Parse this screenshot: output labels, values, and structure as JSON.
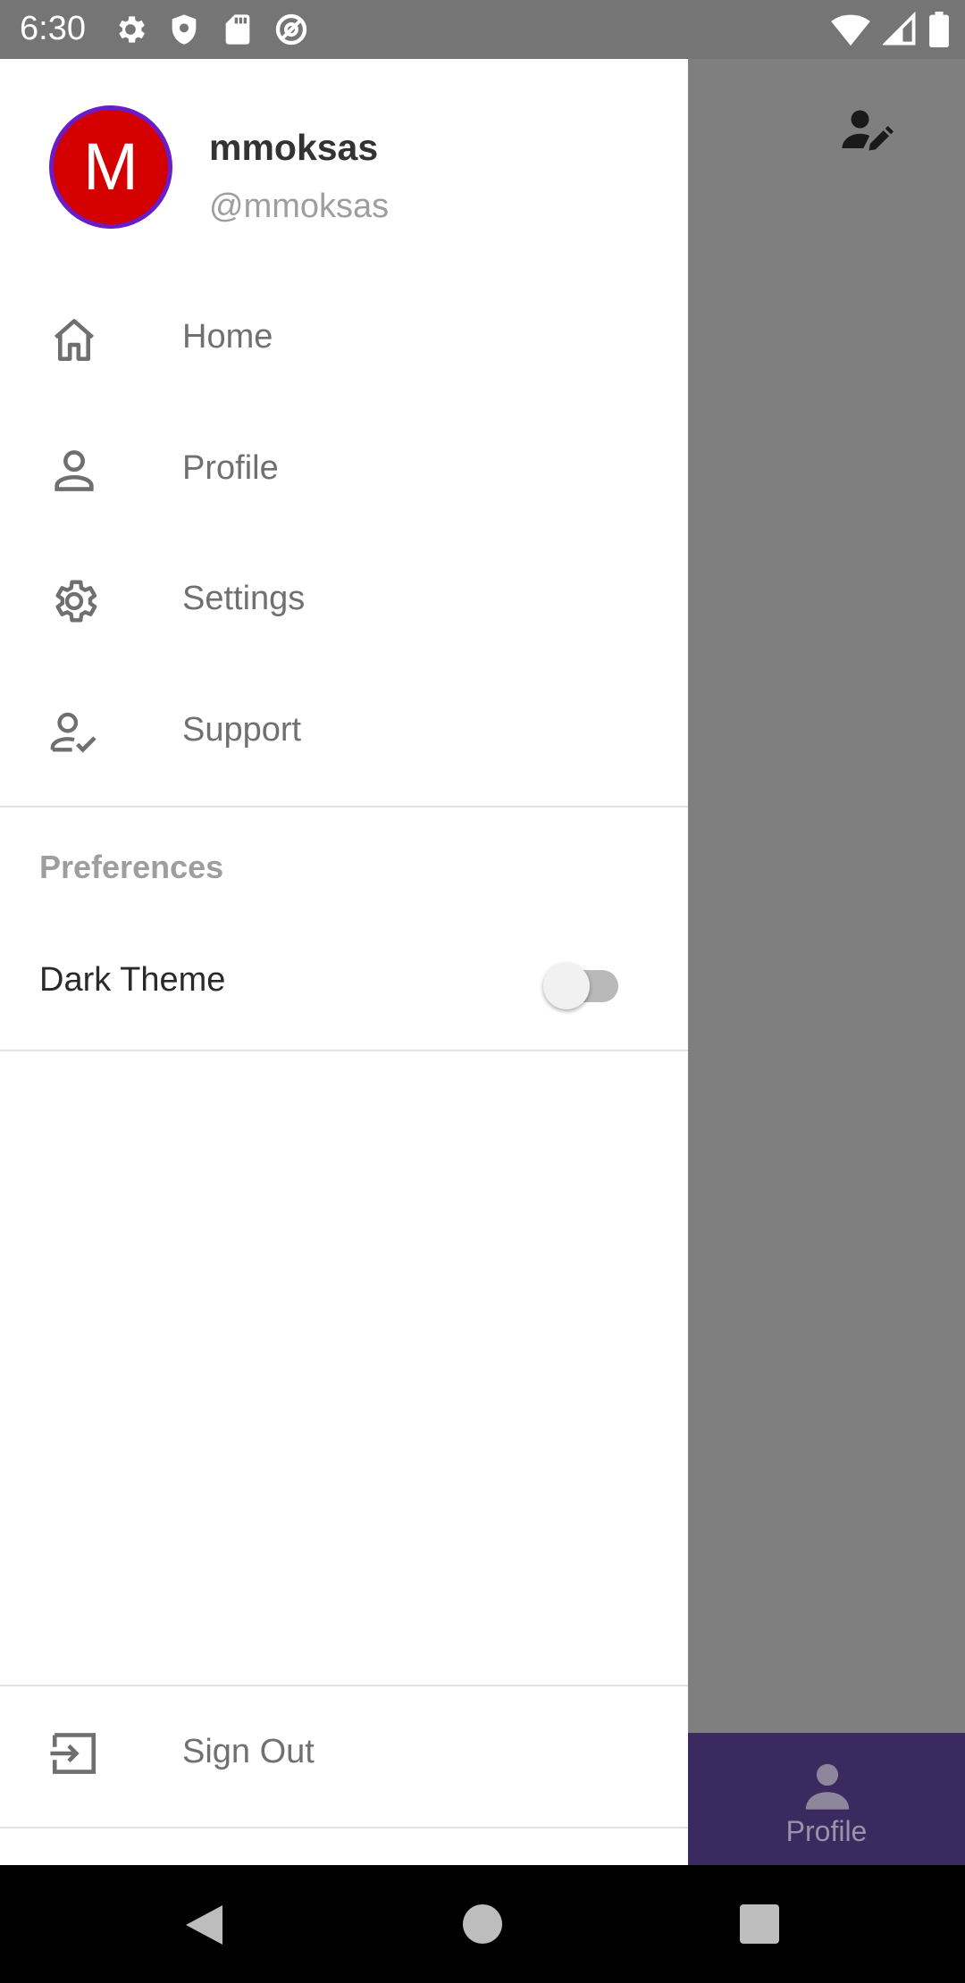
{
  "status_bar": {
    "time": "6:30",
    "left_icons": [
      "gear-icon",
      "shield-icon",
      "sd-card-icon",
      "at-sign-icon"
    ],
    "right_icons": [
      "wifi-icon",
      "cell-signal-icon",
      "battery-icon"
    ]
  },
  "drawer": {
    "avatar_letter": "M",
    "user_name": "mmoksas",
    "user_handle": "@mmoksas",
    "nav_items": [
      {
        "label": "Home",
        "icon": "home-icon"
      },
      {
        "label": "Profile",
        "icon": "person-icon"
      },
      {
        "label": "Settings",
        "icon": "gear-icon"
      },
      {
        "label": "Support",
        "icon": "person-check-icon"
      }
    ],
    "preferences": {
      "header": "Preferences",
      "dark_theme_label": "Dark Theme",
      "dark_theme_enabled": false
    },
    "sign_out_label": "Sign Out"
  },
  "background_app": {
    "top_action_icon": "edit-person-icon",
    "bottom_nav": {
      "label": "Profile",
      "icon": "person-icon"
    }
  },
  "colors": {
    "avatar_bg": "#d40000",
    "avatar_ring": "#6a1cc8",
    "bottom_nav_bg": "#3b2a60",
    "scrim": "#7f7f7f"
  }
}
